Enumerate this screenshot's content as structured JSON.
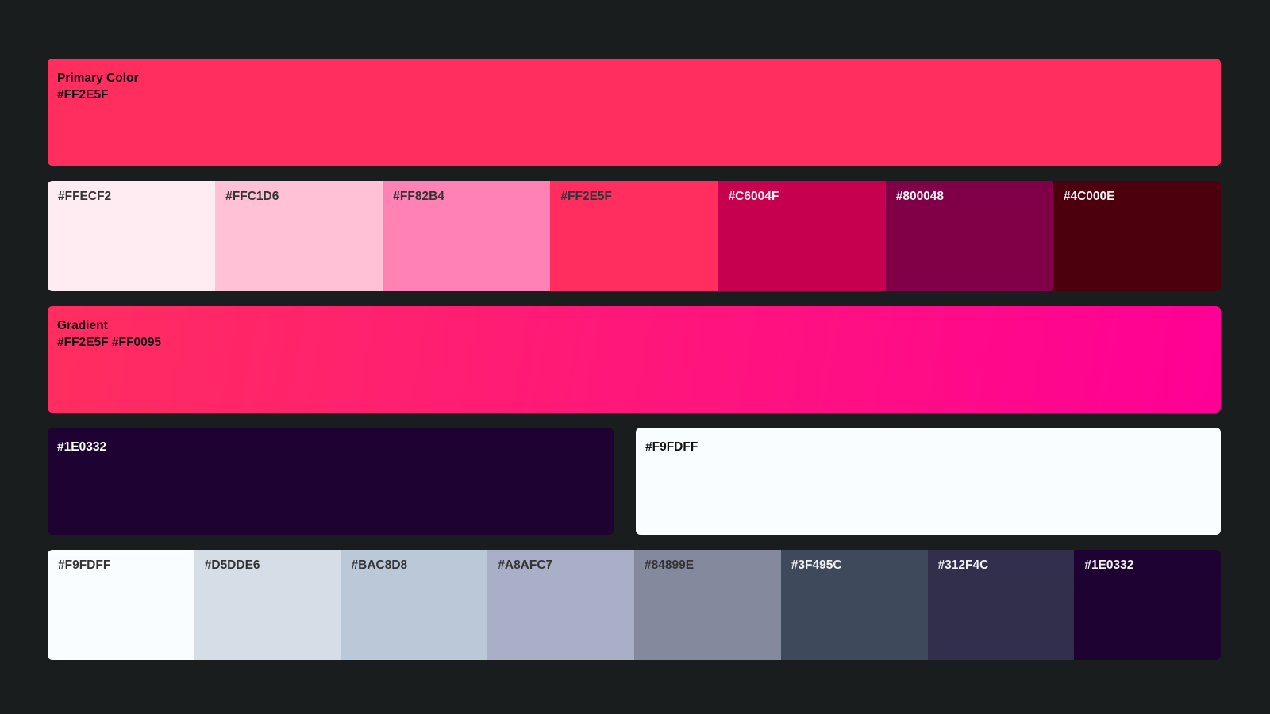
{
  "primary": {
    "title": "Primary Color",
    "hex": "#FF2E5F",
    "color": "#FF2E5F",
    "text_color": "#111111"
  },
  "pink_scale": [
    {
      "hex": "#FFECF2",
      "color": "#FFECF2",
      "text_color": "#333333"
    },
    {
      "hex": "#FFC1D6",
      "color": "#FFC1D6",
      "text_color": "#333333"
    },
    {
      "hex": "#FF82B4",
      "color": "#FF82B4",
      "text_color": "#333333"
    },
    {
      "hex": "#FF2E5F",
      "color": "#FF2E5F",
      "text_color": "#333333"
    },
    {
      "hex": "#C6004F",
      "color": "#C6004F",
      "text_color": "#F2F2F2"
    },
    {
      "hex": "#800048",
      "color": "#800048",
      "text_color": "#F2F2F2"
    },
    {
      "hex": "#4C000E",
      "color": "#4C000E",
      "text_color": "#F2F2F2"
    }
  ],
  "gradient": {
    "title": "Gradient",
    "hex": "#FF2E5F #FF0095",
    "from": "#FF2E5F",
    "to": "#FF0095",
    "text_color": "#111111"
  },
  "dark_block": {
    "hex": "#1E0332",
    "color": "#1E0332",
    "text_color": "#FFFFFF"
  },
  "light_block": {
    "hex": "#F9FDFF",
    "color": "#F9FDFF",
    "text_color": "#111111"
  },
  "neutral_scale": [
    {
      "hex": "#F9FDFF",
      "color": "#F9FDFF",
      "text_color": "#333333"
    },
    {
      "hex": "#D5DDE6",
      "color": "#D5DDE6",
      "text_color": "#333333"
    },
    {
      "hex": "#BAC8D8",
      "color": "#BAC8D8",
      "text_color": "#333333"
    },
    {
      "hex": "#A8AFC7",
      "color": "#A8AFC7",
      "text_color": "#333333"
    },
    {
      "hex": "#84899E",
      "color": "#84899E",
      "text_color": "#333333"
    },
    {
      "hex": "#3F495C",
      "color": "#3F495C",
      "text_color": "#F2F2F2"
    },
    {
      "hex": "#312F4C",
      "color": "#312F4C",
      "text_color": "#F2F2F2"
    },
    {
      "hex": "#1E0332",
      "color": "#1E0332",
      "text_color": "#F2F2F2"
    }
  ],
  "page": {
    "background": "#1A1D1D"
  }
}
